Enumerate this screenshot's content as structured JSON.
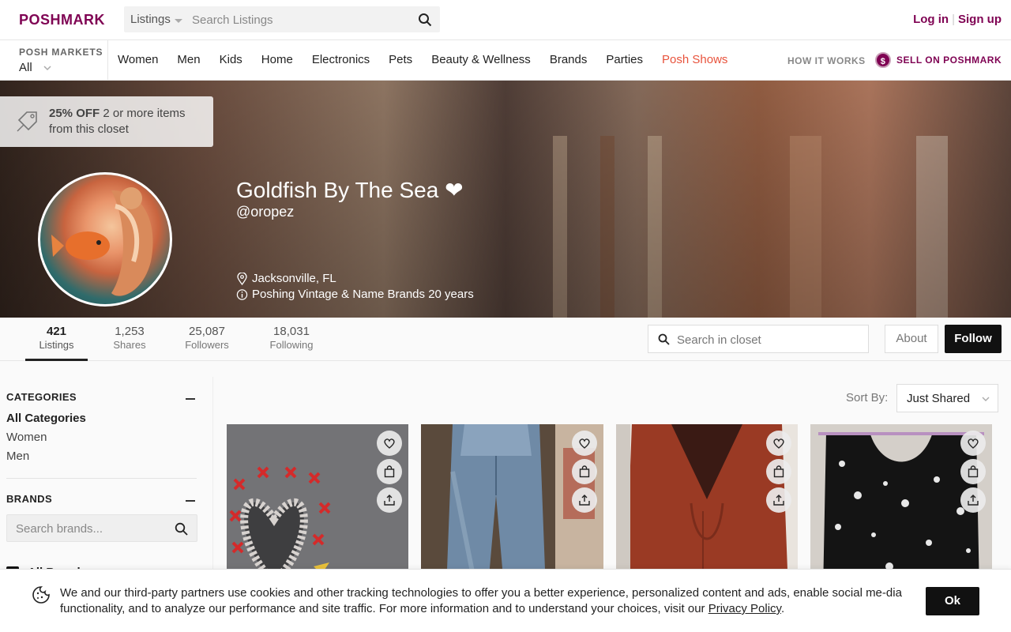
{
  "header": {
    "logo": "POSHMARK",
    "search_scope": "Listings",
    "search_placeholder": "Search Listings",
    "login": "Log in",
    "signup": "Sign up"
  },
  "nav": {
    "markets_label": "POSH MARKETS",
    "markets_value": "All",
    "links": [
      "Women",
      "Men",
      "Kids",
      "Home",
      "Electronics",
      "Pets",
      "Beauty & Wellness",
      "Brands",
      "Parties",
      "Posh Shows"
    ],
    "how_it_works": "HOW IT WORKS",
    "sell": "SELL ON POSHMARK",
    "sell_icon": "$"
  },
  "hero": {
    "promo_bold": "25% OFF",
    "promo_text": " 2 or more items from this closet",
    "closet_name": "Goldfish By The Sea ❤",
    "username": "@oropez",
    "location": "Jacksonville, FL",
    "bio": "Poshing Vintage & Name Brands 20 years"
  },
  "stats": [
    {
      "num": "421",
      "label": "Listings"
    },
    {
      "num": "1,253",
      "label": "Shares"
    },
    {
      "num": "25,087",
      "label": "Followers"
    },
    {
      "num": "18,031",
      "label": "Following"
    }
  ],
  "closet_search_placeholder": "Search in closet",
  "about_label": "About",
  "follow_label": "Follow",
  "sidebar": {
    "categories_title": "CATEGORIES",
    "categories": [
      "All Categories",
      "Women",
      "Men"
    ],
    "brands_title": "BRANDS",
    "brand_search_placeholder": "Search brands...",
    "all_brands": "All Brands"
  },
  "sort": {
    "label": "Sort By:",
    "value": "Just Shared"
  },
  "listings": [
    {
      "name": "denim-heart-patch"
    },
    {
      "name": "wide-leg-jeans"
    },
    {
      "name": "rust-vneck-top"
    },
    {
      "name": "floral-black-top"
    }
  ],
  "cookie": {
    "text": "We and our third-party partners use cookies and other tracking technologies to offer you a better experience, personalized content and ads, enable social me-dia functionality, and to analyze our performance and site traffic. For more information and to understand your choices, visit our ",
    "link": "Privacy Policy",
    "end": ".",
    "ok": "Ok"
  },
  "colors": {
    "brand": "#7f0353",
    "posh_shows": "#e8533c",
    "button_dark": "#111111"
  }
}
